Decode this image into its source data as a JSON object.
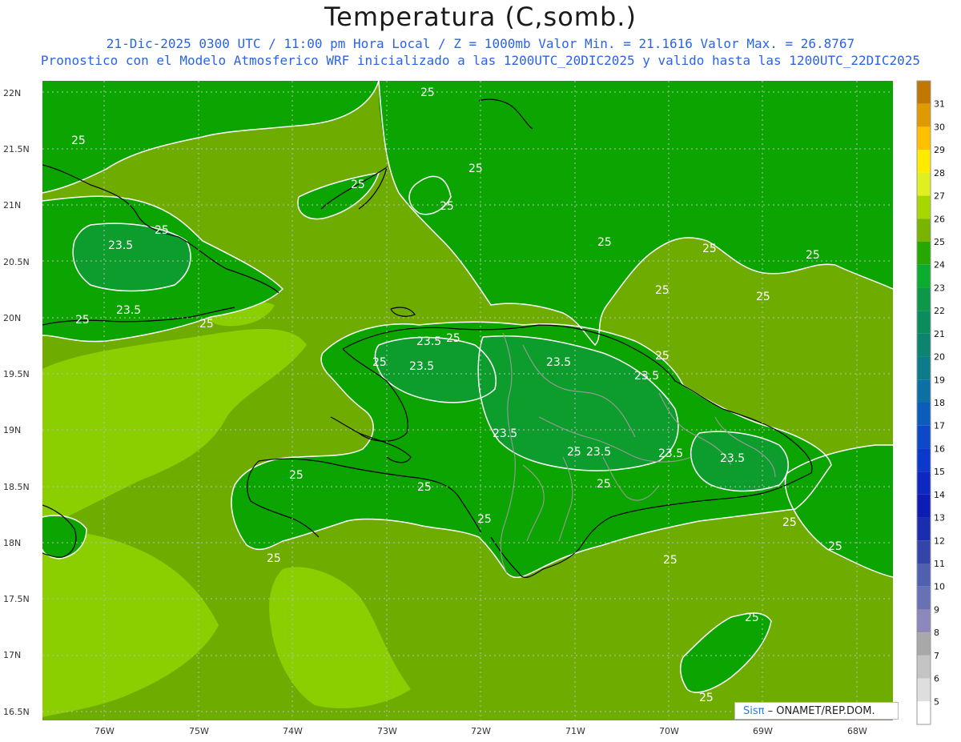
{
  "title": "Temperatura (C,somb.)",
  "subtitle_line1": "21-Dic-2025 0300 UTC / 11:00 pm Hora Local / Z = 1000mb  Valor Min. = 21.1616  Valor Max. = 26.8767",
  "subtitle_line2": "Pronostico con el Modelo Atmosferico WRF inicializado a las 1200UTC_20DIC2025 y valido hasta las  1200UTC_22DIC2025",
  "lat_labels": [
    "22N",
    "21.5N",
    "21N",
    "20.5N",
    "20N",
    "19.5N",
    "19N",
    "18.5N",
    "18N",
    "17.5N",
    "17N",
    "16.5N"
  ],
  "lon_labels": [
    "76W",
    "75W",
    "74W",
    "73W",
    "72W",
    "71W",
    "70W",
    "69W",
    "68W"
  ],
  "colorbar": {
    "labels": [
      "31",
      "30",
      "29",
      "28",
      "27",
      "26",
      "25",
      "24",
      "23",
      "22",
      "21",
      "20",
      "19",
      "18",
      "17",
      "16",
      "15",
      "14",
      "13",
      "12",
      "11",
      "10",
      "9",
      "8",
      "7",
      "6",
      "5"
    ],
    "colors": [
      "#c07800",
      "#e09a00",
      "#ffc000",
      "#ffea00",
      "#e0ef20",
      "#a6d800",
      "#78b400",
      "#26a800",
      "#0cac30",
      "#0c9848",
      "#0c8c5c",
      "#0c8470",
      "#0c7c8a",
      "#0c70a4",
      "#0c5cbc",
      "#0c48c8",
      "#0c38cc",
      "#0c28c0",
      "#0c1cb4",
      "#1c2cae",
      "#3444a8",
      "#5060b0",
      "#6870b6",
      "#8c88bc",
      "#a8a8a8",
      "#c4c4c4",
      "#dedede",
      "#ffffff"
    ]
  },
  "contour_labels": [
    "25",
    "23.5"
  ],
  "credit": {
    "sis": "Sisπ",
    "rest": "– ONAMET/REP.DOM."
  },
  "colors": {
    "land_green": "#0ba400",
    "sea_olive": "#6fac00",
    "light_green": "#8bcf00",
    "contour": "#ffffff",
    "coast": "#000000",
    "borders": "#999999"
  }
}
